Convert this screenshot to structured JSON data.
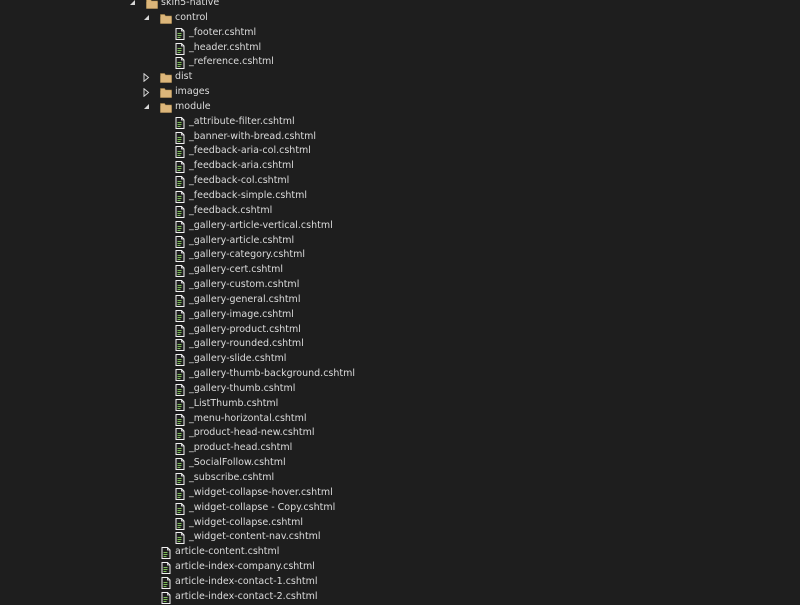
{
  "tree": {
    "root": {
      "label": "skin5-native",
      "icon": "folder-icon",
      "state": "expanded"
    },
    "control": {
      "label": "control",
      "icon": "folder-icon",
      "state": "expanded",
      "files": [
        "_footer.cshtml",
        "_header.cshtml",
        "_reference.cshtml"
      ]
    },
    "dist": {
      "label": "dist",
      "icon": "folder-icon",
      "state": "collapsed"
    },
    "images": {
      "label": "images",
      "icon": "folder-icon",
      "state": "collapsed"
    },
    "module": {
      "label": "module",
      "icon": "folder-icon",
      "state": "expanded",
      "files": [
        "_attribute-filter.cshtml",
        "_banner-with-bread.cshtml",
        "_feedback-aria-col.cshtml",
        "_feedback-aria.cshtml",
        "_feedback-col.cshtml",
        "_feedback-simple.cshtml",
        "_feedback.cshtml",
        "_gallery-article-vertical.cshtml",
        "_gallery-article.cshtml",
        "_gallery-category.cshtml",
        "_gallery-cert.cshtml",
        "_gallery-custom.cshtml",
        "_gallery-general.cshtml",
        "_gallery-image.cshtml",
        "_gallery-product.cshtml",
        "_gallery-rounded.cshtml",
        "_gallery-slide.cshtml",
        "_gallery-thumb-background.cshtml",
        "_gallery-thumb.cshtml",
        "_ListThumb.cshtml",
        "_menu-horizontal.cshtml",
        "_product-head-new.cshtml",
        "_product-head.cshtml",
        "_SocialFollow.cshtml",
        "_subscribe.cshtml",
        "_widget-collapse-hover.cshtml",
        "_widget-collapse - Copy.cshtml",
        "_widget-collapse.cshtml",
        "_widget-content-nav.cshtml"
      ]
    },
    "root_files": [
      "article-content.cshtml",
      "article-index-company.cshtml",
      "article-index-contact-1.cshtml",
      "article-index-contact-2.cshtml"
    ]
  },
  "colors": {
    "background": "#1e1e1e",
    "text": "#dcdcdc",
    "folder": "#dcb67a",
    "file_page": "#f2f2f2",
    "file_accent": "#7fbf5a"
  }
}
